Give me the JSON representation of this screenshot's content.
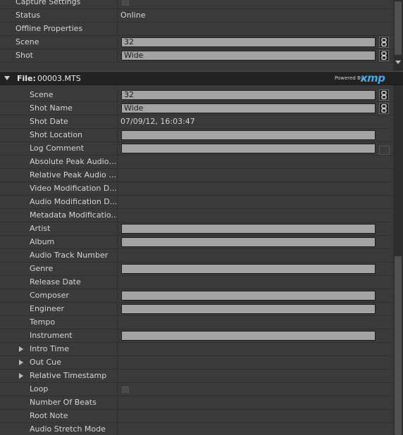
{
  "top_panel": {
    "rows": [
      {
        "label": "Capture Settings",
        "kind": "checkbox"
      },
      {
        "label": "Status",
        "kind": "text",
        "value": "Online"
      },
      {
        "label": "Offline Properties",
        "kind": "none"
      },
      {
        "label": "Scene",
        "kind": "field",
        "value": "32",
        "link": true
      },
      {
        "label": "Shot",
        "kind": "field",
        "value": "Wide",
        "link": true
      }
    ]
  },
  "file_header": {
    "label": "File:",
    "filename": "00003.MTS",
    "powered_by": "Powered By",
    "brand": "xmp"
  },
  "file_panel": {
    "rows": [
      {
        "label": "Scene",
        "kind": "field",
        "value": "32",
        "link": true
      },
      {
        "label": "Shot Name",
        "kind": "field",
        "value": "Wide",
        "link": true
      },
      {
        "label": "Shot Date",
        "kind": "text",
        "value": "07/09/12, 16:03:47"
      },
      {
        "label": "Shot Location",
        "kind": "field",
        "value": ""
      },
      {
        "label": "Log Comment",
        "kind": "field",
        "value": "",
        "box": true
      },
      {
        "label": "Absolute Peak Audio ...",
        "kind": "none"
      },
      {
        "label": "Relative Peak Audio Fi...",
        "kind": "none"
      },
      {
        "label": "Video Modification D...",
        "kind": "none"
      },
      {
        "label": "Audio Modification D...",
        "kind": "none"
      },
      {
        "label": "Metadata Modificatio...",
        "kind": "none"
      },
      {
        "label": "Artist",
        "kind": "field",
        "value": ""
      },
      {
        "label": "Album",
        "kind": "field",
        "value": ""
      },
      {
        "label": "Audio Track Number",
        "kind": "none"
      },
      {
        "label": "Genre",
        "kind": "field",
        "value": ""
      },
      {
        "label": "Release Date",
        "kind": "none"
      },
      {
        "label": "Composer",
        "kind": "field",
        "value": ""
      },
      {
        "label": "Engineer",
        "kind": "field",
        "value": ""
      },
      {
        "label": "Tempo",
        "kind": "none"
      },
      {
        "label": "Instrument",
        "kind": "field",
        "value": ""
      },
      {
        "label": "Intro Time",
        "kind": "none",
        "expander": true
      },
      {
        "label": "Out Cue",
        "kind": "none",
        "expander": true
      },
      {
        "label": "Relative Timestamp",
        "kind": "none",
        "expander": true
      },
      {
        "label": "Loop",
        "kind": "checkbox"
      },
      {
        "label": "Number Of Beats",
        "kind": "none"
      },
      {
        "label": "Root Note",
        "kind": "none"
      },
      {
        "label": "Audio Stretch Mode",
        "kind": "none"
      }
    ]
  }
}
